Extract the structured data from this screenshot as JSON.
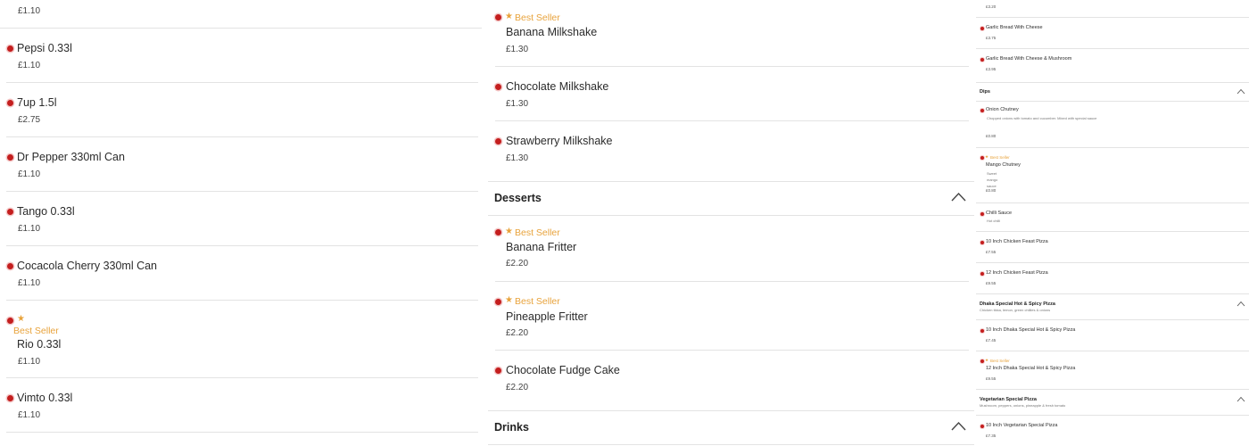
{
  "col1": {
    "top_partial_price": "£1.10",
    "items": [
      {
        "name": "Pepsi 0.33l",
        "price": "£1.10",
        "best_seller": false
      },
      {
        "name": "7up 1.5l",
        "price": "£2.75",
        "best_seller": false
      },
      {
        "name": "Dr Pepper 330ml Can",
        "price": "£1.10",
        "best_seller": false
      },
      {
        "name": "Tango 0.33l",
        "price": "£1.10",
        "best_seller": false
      },
      {
        "name": "Cocacola Cherry 330ml Can",
        "price": "£1.10",
        "best_seller": false
      },
      {
        "name": "Rio 0.33l",
        "price": "£1.10",
        "best_seller": true,
        "badge": "Best Seller"
      },
      {
        "name": "Vimto 0.33l",
        "price": "£1.10",
        "best_seller": false
      }
    ]
  },
  "col2": {
    "items_top": [
      {
        "name": "Banana Milkshake",
        "price": "£1.30",
        "best_seller": true,
        "badge": "Best Seller"
      },
      {
        "name": "Chocolate Milkshake",
        "price": "£1.30",
        "best_seller": false
      },
      {
        "name": "Strawberry Milkshake",
        "price": "£1.30",
        "best_seller": false
      }
    ],
    "desserts": {
      "title": "Desserts",
      "items": [
        {
          "name": "Banana Fritter",
          "price": "£2.20",
          "best_seller": true,
          "badge": "Best Seller"
        },
        {
          "name": "Pineapple Fritter",
          "price": "£2.20",
          "best_seller": true,
          "badge": "Best Seller"
        },
        {
          "name": "Chocolate Fudge Cake",
          "price": "£2.20",
          "best_seller": false
        }
      ]
    },
    "drinks": {
      "title": "Drinks"
    }
  },
  "col3": {
    "top_partial_price": "£3.20",
    "items_top": [
      {
        "name": "Garlic Bread With Cheese",
        "price": "£3.75"
      },
      {
        "name": "Garlic Bread With Cheese & Mushroom",
        "price": "£3.95"
      }
    ],
    "dips": {
      "title": "Dips",
      "items": [
        {
          "name": "Onion Chutney",
          "desc": "Chopped onions with tomato and cucumber. Mixed with special sauce",
          "price": "£0.80",
          "best_seller": false
        },
        {
          "name": "Mango Chutney",
          "desc": "Sweet mango sauce",
          "price": "£0.80",
          "best_seller": true,
          "badge": "Best Seller"
        },
        {
          "name": "Chilli Sauce",
          "desc": "Hot chilli",
          "price": "",
          "best_seller": false
        }
      ]
    },
    "pizza_items": [
      {
        "name": "10 Inch Chicken Feast Pizza",
        "price": "£7.55"
      },
      {
        "name": "12 Inch Chicken Feast Pizza",
        "price": "£9.55"
      }
    ],
    "dhaka": {
      "title": "Dhaka Special Hot & Spicy Pizza",
      "desc": "Chicken tikka, lemon, green chillies & onions",
      "items": [
        {
          "name": "10 Inch Dhaka Special Hot & Spicy Pizza",
          "price": "£7.45",
          "best_seller": false
        },
        {
          "name": "12 Inch Dhaka Special Hot & Spicy Pizza",
          "price": "£9.55",
          "best_seller": true,
          "badge": "Best Seller"
        }
      ]
    },
    "veg": {
      "title": "Vegetarian Special Pizza",
      "desc": "Mushroom, peppers, onions, pineapple & fresh tomato",
      "items": [
        {
          "name": "10 Inch Vegetarian Special Pizza",
          "price": "£7.35"
        }
      ]
    }
  },
  "icons": {
    "dot": "veg-indicator-icon",
    "star": "star-icon",
    "chevron": "chevron-up-icon"
  },
  "colors": {
    "accent": "#e8a33c",
    "dot": "#c41e1e",
    "divider": "#e3e3e3"
  }
}
